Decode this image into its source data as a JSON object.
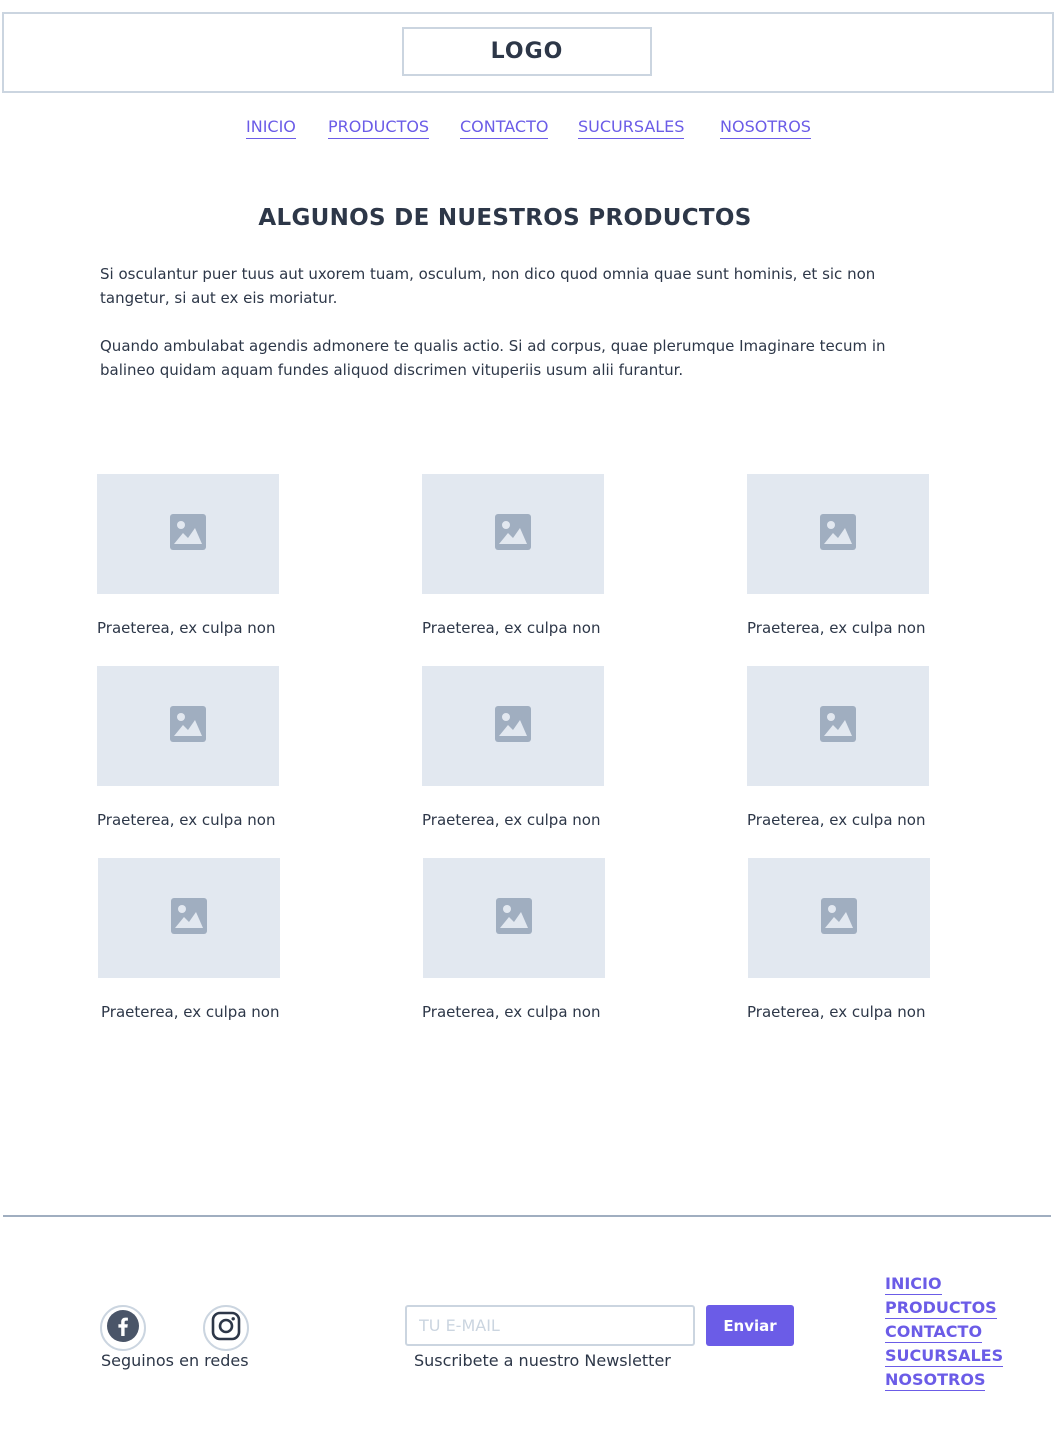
{
  "header": {
    "logo": "LOGO"
  },
  "nav": {
    "items": [
      {
        "label": "INICIO"
      },
      {
        "label": "PRODUCTOS"
      },
      {
        "label": "CONTACTO"
      },
      {
        "label": "SUCURSALES"
      },
      {
        "label": "NOSOTROS"
      }
    ]
  },
  "main": {
    "title": "ALGUNOS DE NUESTROS PRODUCTOS",
    "paragraphs": [
      "Si osculantur puer tuus aut uxorem tuam, osculum, non dico quod omnia quae sunt hominis, et sic non tangetur, si aut ex eis moriatur.",
      "Quando ambulabat agendis admonere te qualis actio. Si ad corpus, quae plerumque Imaginare tecum in balineo quidam aquam fundes aliquod discrimen vituperiis usum alii furantur."
    ],
    "products": [
      {
        "caption": "Praeterea, ex culpa non",
        "icon": "image-placeholder-icon"
      },
      {
        "caption": "Praeterea, ex culpa non",
        "icon": "image-placeholder-icon"
      },
      {
        "caption": "Praeterea, ex culpa non",
        "icon": "image-placeholder-icon"
      },
      {
        "caption": "Praeterea, ex culpa non",
        "icon": "image-placeholder-icon"
      },
      {
        "caption": "Praeterea, ex culpa non",
        "icon": "image-placeholder-icon"
      },
      {
        "caption": "Praeterea, ex culpa non",
        "icon": "image-placeholder-icon"
      },
      {
        "caption": "Praeterea, ex culpa non",
        "icon": "image-placeholder-icon"
      },
      {
        "caption": "Praeterea, ex culpa non",
        "icon": "image-placeholder-icon"
      },
      {
        "caption": "Praeterea, ex culpa non",
        "icon": "image-placeholder-icon"
      }
    ]
  },
  "footer": {
    "social": {
      "icons": [
        "facebook-icon",
        "instagram-icon"
      ],
      "label": "Seguinos en redes"
    },
    "newsletter": {
      "placeholder": "TU E-MAIL",
      "value": "",
      "button": "Enviar",
      "label": "Suscribete a nuestro Newsletter"
    },
    "nav": [
      {
        "label": "INICIO"
      },
      {
        "label": "PRODUCTOS"
      },
      {
        "label": "CONTACTO"
      },
      {
        "label": "SUCURSALES"
      },
      {
        "label": "NOSOTROS"
      }
    ]
  },
  "colors": {
    "accent": "#6b5ce7",
    "text": "#2d3748",
    "placeholder_bg": "#e2e8f0",
    "placeholder_icon": "#a0aec0",
    "border": "#cbd5e0"
  }
}
